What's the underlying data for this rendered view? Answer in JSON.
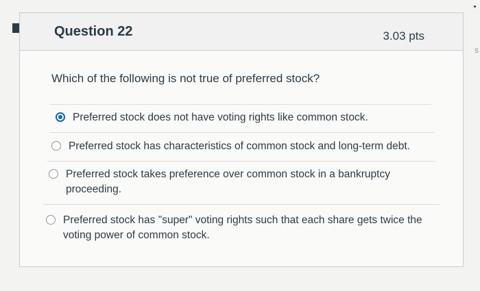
{
  "question": {
    "title": "Question 22",
    "points": "3.03 pts",
    "text": "Which of the following is not true of preferred stock?"
  },
  "answers": [
    {
      "label": "Preferred stock does not have voting rights like common stock.",
      "selected": true
    },
    {
      "label": "Preferred stock has characteristics of common stock and long-term debt.",
      "selected": false
    },
    {
      "label": "Preferred stock takes preference over common stock in a bankruptcy proceeding.",
      "selected": false
    },
    {
      "label": "Preferred stock has \"super\" voting rights such that each share gets twice the voting power of common stock.",
      "selected": false
    }
  ],
  "edge": {
    "right_glyph": "s"
  },
  "colors": {
    "accent": "#0b66c3",
    "text": "#2d3b45",
    "border": "#c7cdd1"
  }
}
